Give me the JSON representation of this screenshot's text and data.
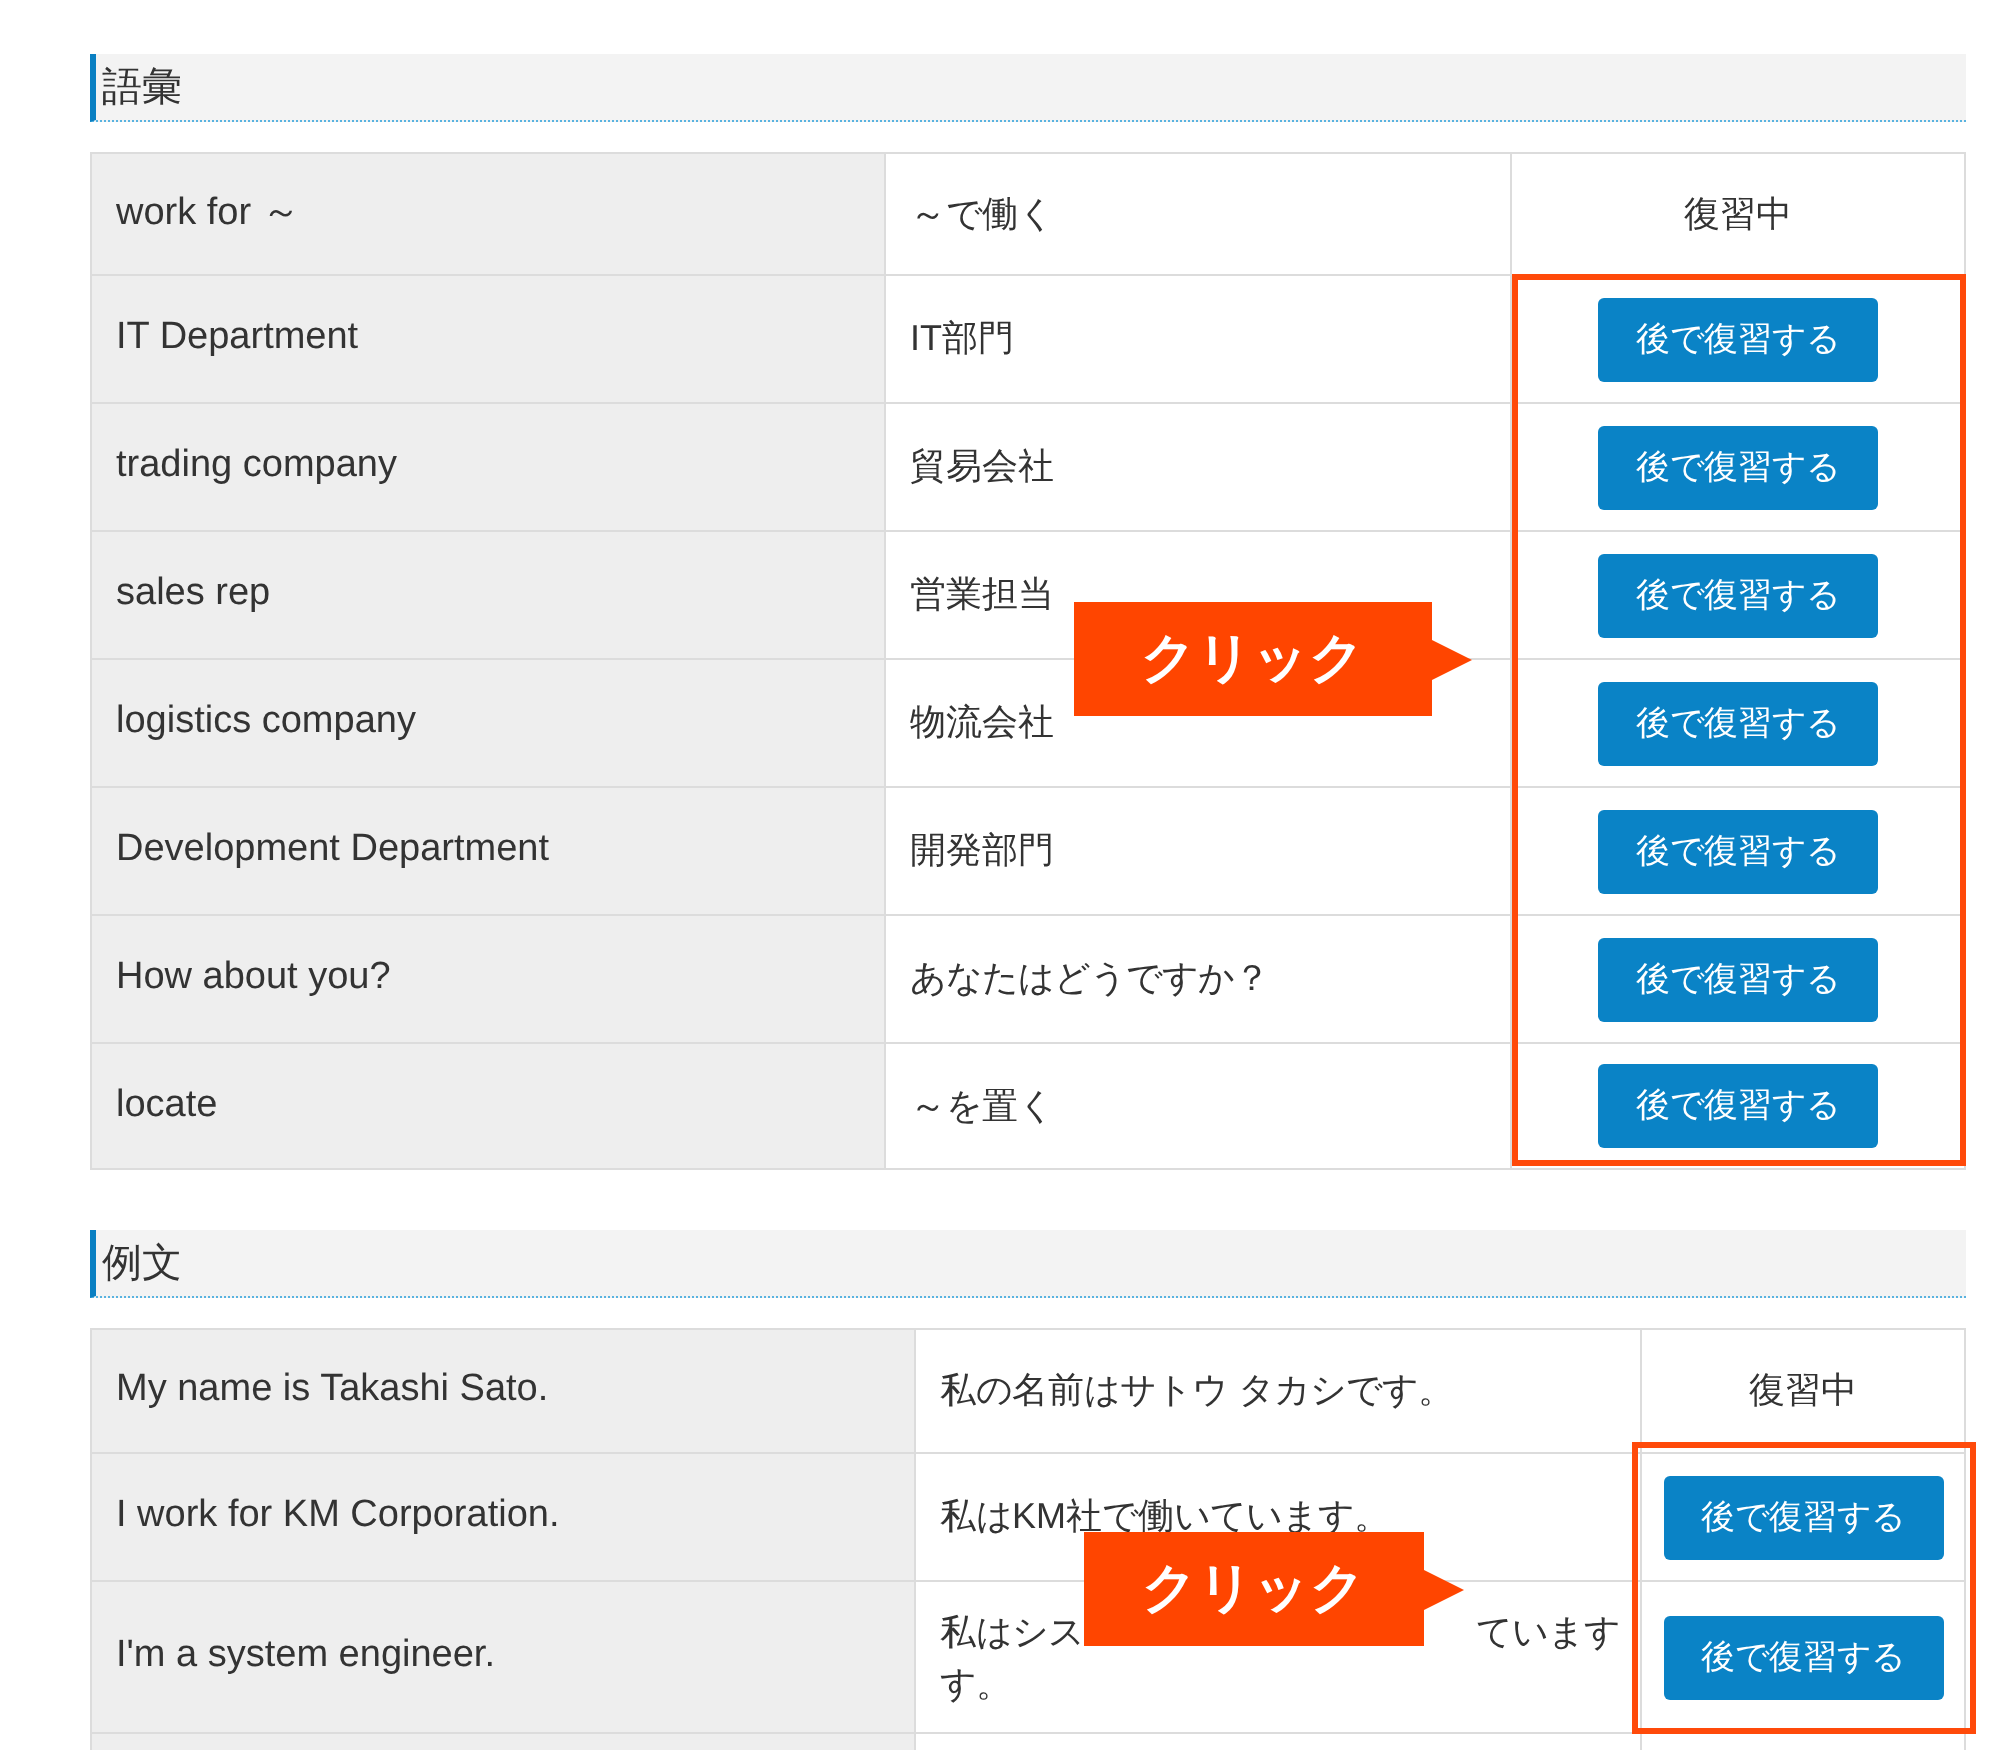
{
  "sections": [
    {
      "title": "語彙",
      "header": {
        "english": "work for ～",
        "japanese": "～で働く",
        "status": "復習中"
      },
      "highlighted": true,
      "callout": "クリック",
      "rows": [
        {
          "english": "IT Department",
          "japanese": "IT部門",
          "button": "後で復習する"
        },
        {
          "english": "trading company",
          "japanese": "貿易会社",
          "button": "後で復習する"
        },
        {
          "english": "sales rep",
          "japanese": "営業担当",
          "button": "後で復習する"
        },
        {
          "english": "logistics company",
          "japanese": "物流会社",
          "button": "後で復習する"
        },
        {
          "english": "Development Department",
          "japanese": "開発部門",
          "button": "後で復習する"
        },
        {
          "english": "How about you?",
          "japanese": "あなたはどうですか？",
          "button": "後で復習する"
        },
        {
          "english": "locate",
          "japanese": "～を置く",
          "button": "後で復習する"
        }
      ]
    },
    {
      "title": "例文",
      "header": {
        "english": "My name is Takashi Sato.",
        "japanese": "私の名前はサトウ タカシです。",
        "status": "復習中"
      },
      "highlighted": true,
      "callout": "クリック",
      "partial_row": true,
      "rows": [
        {
          "english": "I work for KM Corporation.",
          "japanese": "私はKM社で働いています。",
          "button": "後で復習する"
        },
        {
          "english": "I'm a system engineer.",
          "japanese_parts": [
            "私はシス",
            "ています",
            "す。"
          ],
          "button": "後で復習する"
        }
      ]
    }
  ]
}
